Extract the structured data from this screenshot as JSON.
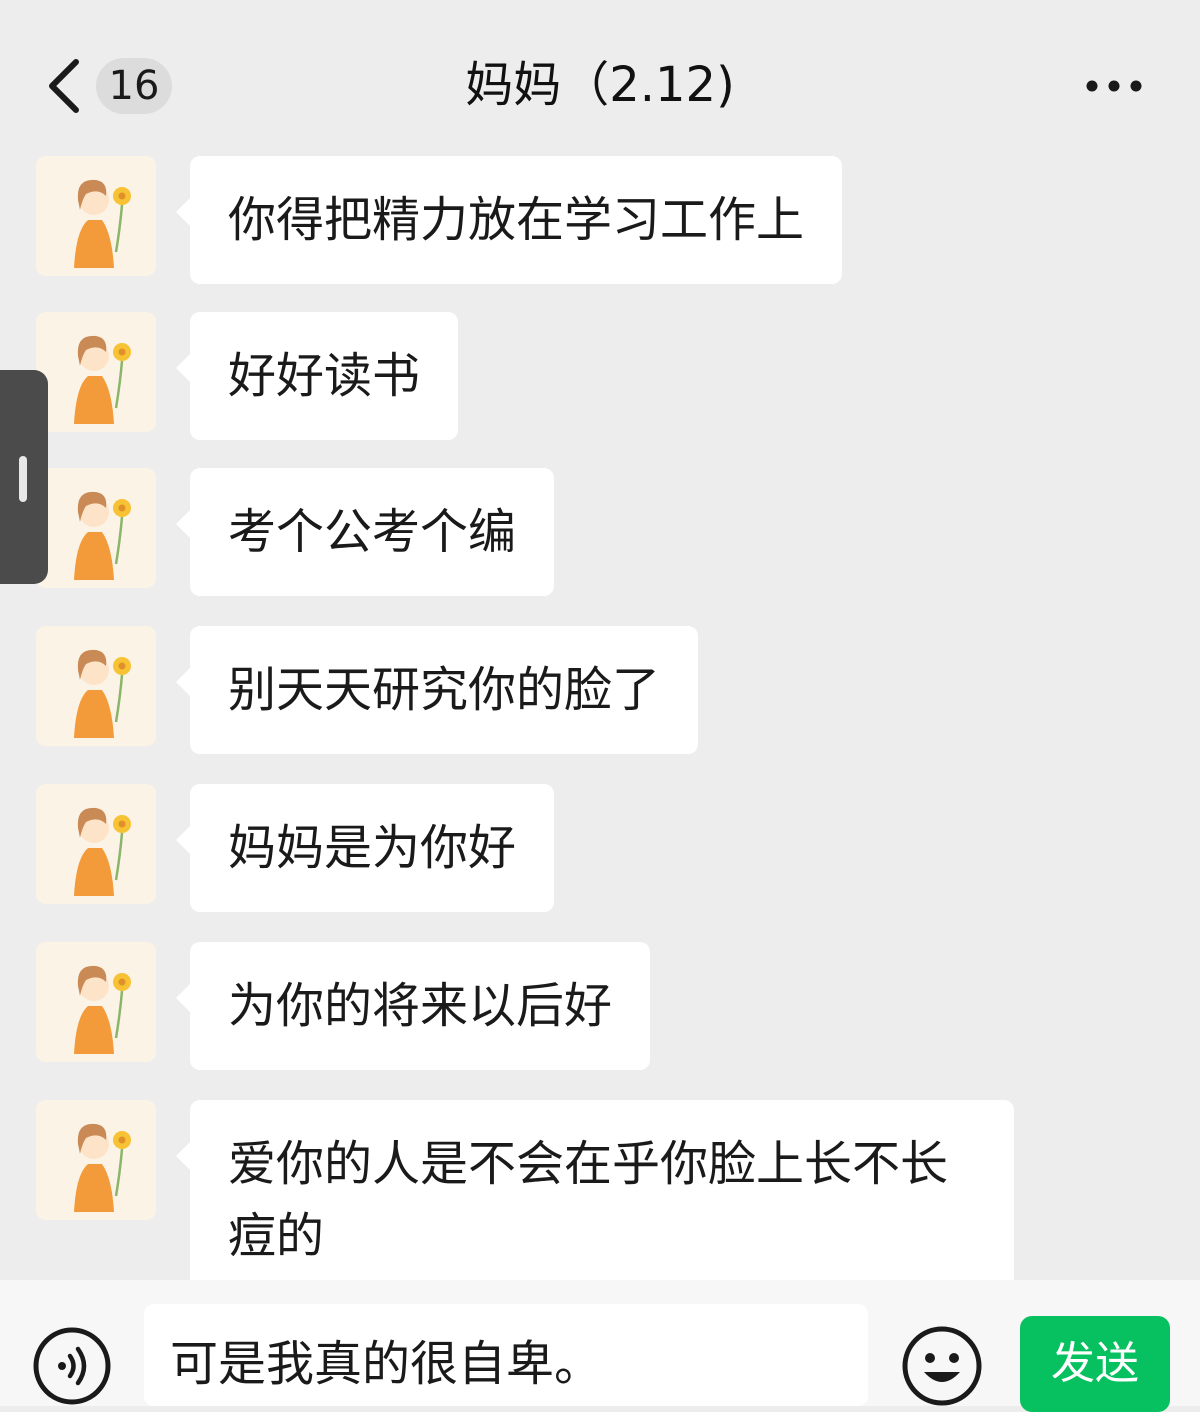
{
  "header": {
    "back_icon": "chevron-left-icon",
    "unread_count": "16",
    "title": "妈妈（2.12)",
    "more_icon": "more-dots-icon"
  },
  "messages": [
    {
      "sender": "妈妈",
      "text": "你得把精力放在学习工作上"
    },
    {
      "sender": "妈妈",
      "text": "好好读书"
    },
    {
      "sender": "妈妈",
      "text": "考个公考个编"
    },
    {
      "sender": "妈妈",
      "text": "别天天研究你的脸了"
    },
    {
      "sender": "妈妈",
      "text": "妈妈是为你好"
    },
    {
      "sender": "妈妈",
      "text": "为你的将来以后好"
    },
    {
      "sender": "妈妈",
      "text": "爱你的人是不会在乎你脸上长不长痘的"
    }
  ],
  "composer": {
    "voice_icon": "voice-input-icon",
    "input_value": "可是我真的很自卑。",
    "emoji_icon": "emoji-icon",
    "send_label": "发送"
  },
  "colors": {
    "background": "#ededed",
    "bubble": "#ffffff",
    "send_button": "#07c160",
    "side_tab": "#4b4b4b"
  }
}
